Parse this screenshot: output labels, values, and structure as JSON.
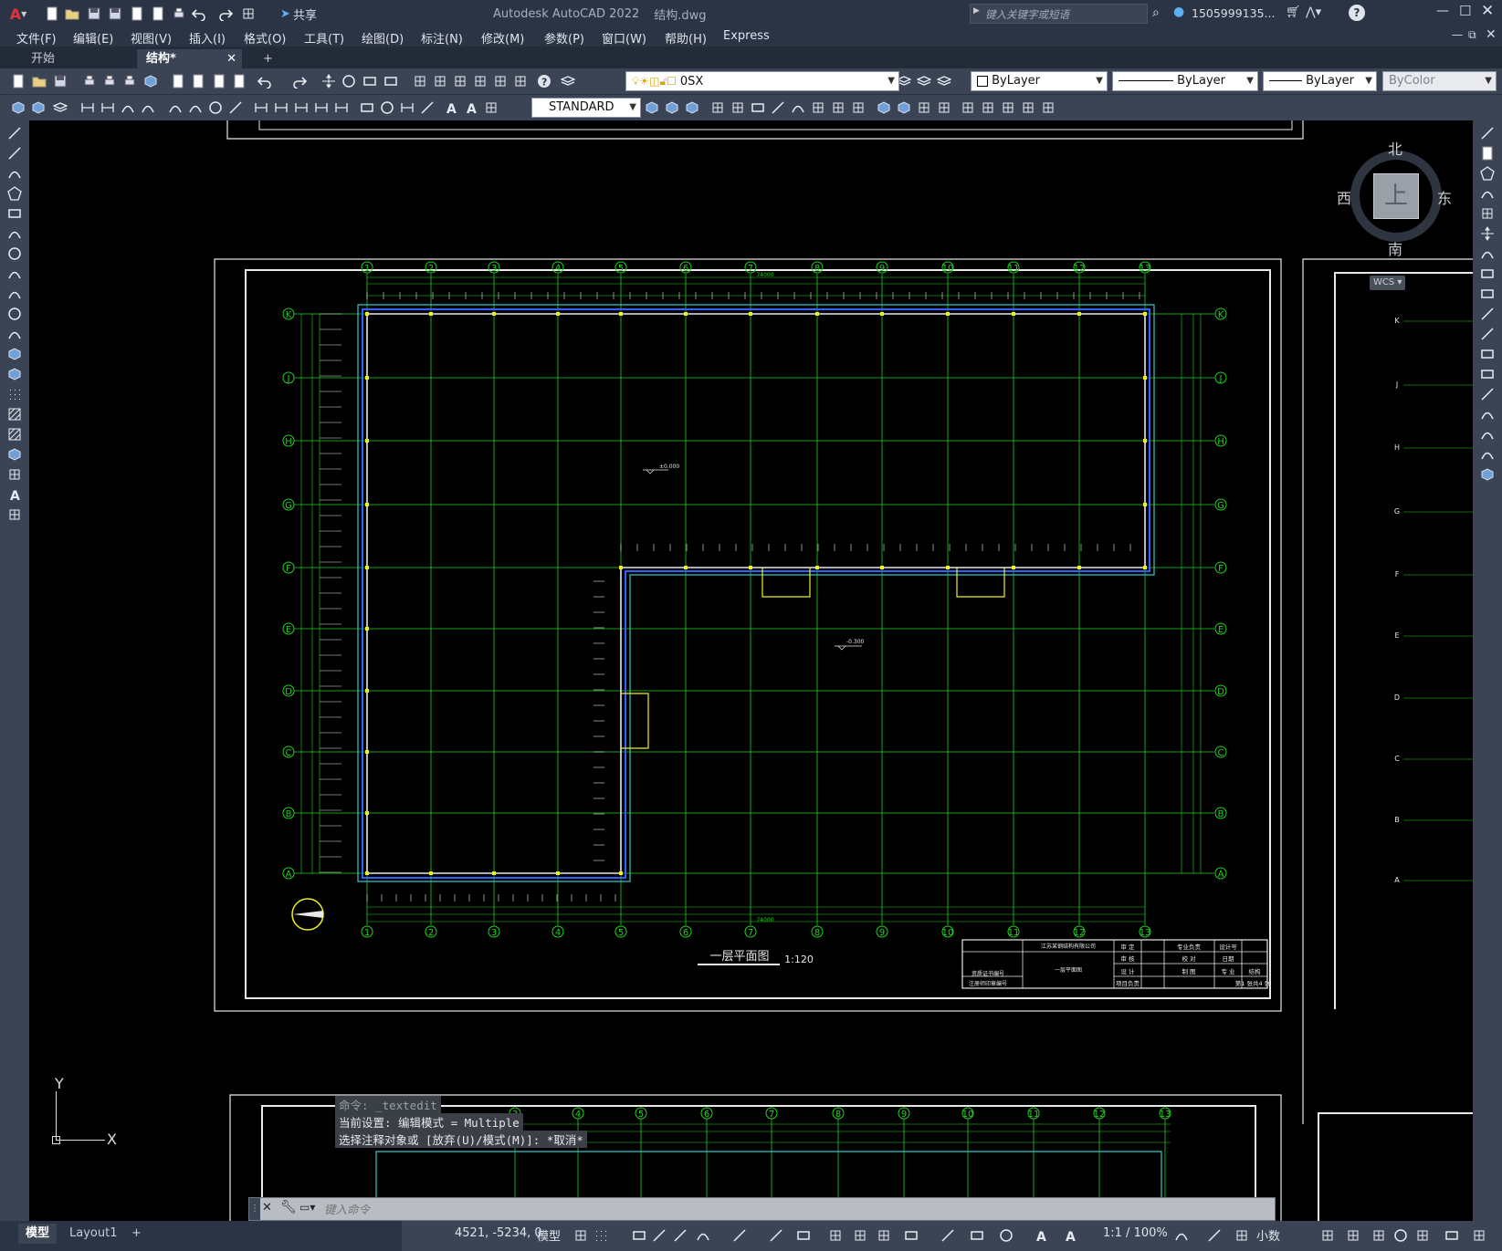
{
  "app": {
    "title": "Autodesk AutoCAD 2022",
    "filename": "结构.dwg",
    "search_placeholder": "键入关键字或短语",
    "user": "1505999135...",
    "share": "共享"
  },
  "menu": [
    "文件(F)",
    "编辑(E)",
    "视图(V)",
    "插入(I)",
    "格式(O)",
    "工具(T)",
    "绘图(D)",
    "标注(N)",
    "修改(M)",
    "参数(P)",
    "窗口(W)",
    "帮助(H)",
    "Express"
  ],
  "tabs": [
    {
      "label": "开始"
    },
    {
      "label": "结构*"
    }
  ],
  "toolbar": {
    "layer": "0SX",
    "color": "ByLayer",
    "linetype": "ByLayer",
    "lineweight": "ByLayer",
    "plotstyle": "ByColor",
    "textstyle": "STANDARD"
  },
  "viewcube": {
    "north": "北",
    "south": "南",
    "east": "东",
    "west": "西",
    "top": "上",
    "wcs": "WCS"
  },
  "ucs": {
    "x": "X",
    "y": "Y"
  },
  "drawing": {
    "title": "一层平面图",
    "scale": "1:120",
    "col_labels": [
      "1",
      "2",
      "3",
      "4",
      "5",
      "6",
      "7",
      "8",
      "9",
      "10",
      "11",
      "12",
      "13"
    ],
    "row_labels": [
      "K",
      "J",
      "H",
      "G",
      "F",
      "E",
      "D",
      "C",
      "B",
      "A"
    ],
    "lower_col_labels": [
      "3",
      "4",
      "5",
      "6",
      "7",
      "8",
      "9",
      "10",
      "11",
      "12",
      "13"
    ],
    "level_1": "±0.000",
    "level_2": "-0.300",
    "total_dim": "74000",
    "titleblock": {
      "company": "江苏某钢结构有限公司",
      "drawing_name": "一层平面图",
      "cert_no": "资质证书编号",
      "reg_no": "注册师印章编号",
      "cells": [
        "审 定",
        "审 核",
        "设 计",
        "项目负责",
        "专业负责",
        "校 对",
        "制 图",
        "设计号",
        "日期",
        "专 业",
        "第1 张共4 张",
        "结构"
      ]
    }
  },
  "command": {
    "history": [
      "命令: _textedit",
      "当前设置: 编辑模式 = Multiple",
      "选择注释对象或 [放弃(U)/模式(M)]: *取消*"
    ],
    "placeholder": "键入命令"
  },
  "status": {
    "model_tab": "模型",
    "layout_tab": "Layout1",
    "coords": "4521, -5234, 0",
    "space": "模型",
    "scale": "1:1 / 100%",
    "units": "小数"
  }
}
